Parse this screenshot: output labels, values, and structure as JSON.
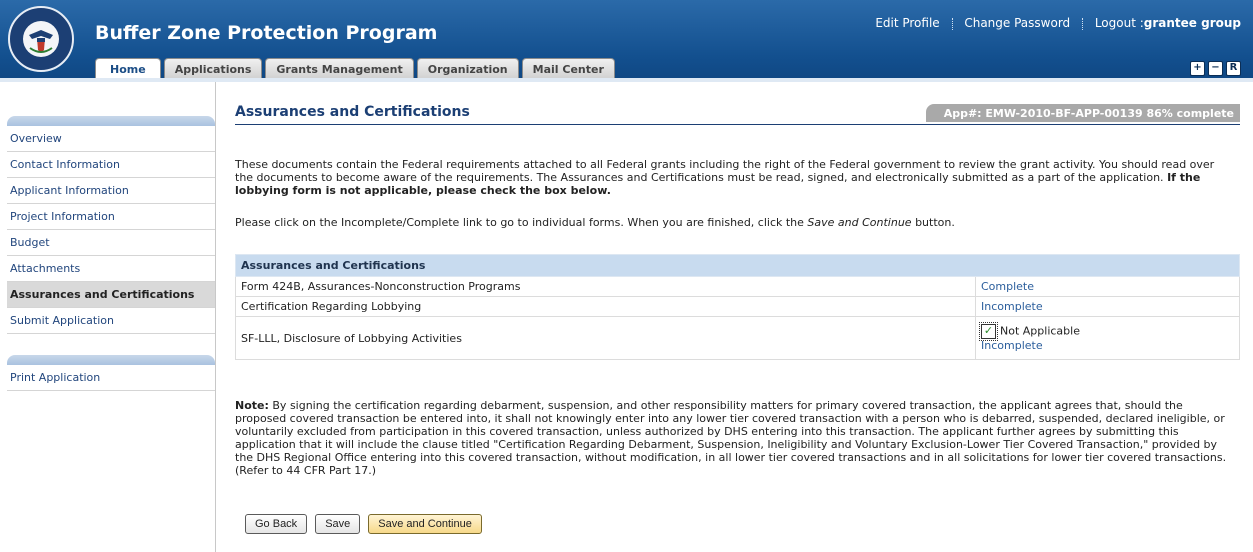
{
  "header": {
    "app_title": "Buffer Zone Protection Program",
    "links": {
      "edit_profile": "Edit Profile",
      "change_password": "Change Password",
      "logout": "Logout :",
      "user": "grantee group"
    },
    "tabs": [
      "Home",
      "Applications",
      "Grants Management",
      "Organization",
      "Mail Center"
    ],
    "window_buttons": [
      "+",
      "−",
      "R"
    ]
  },
  "sidebar": {
    "items": [
      "Overview",
      "Contact Information",
      "Applicant Information",
      "Project Information",
      "Budget",
      "Attachments",
      "Assurances and Certifications",
      "Submit Application"
    ],
    "active": "Assurances and Certifications",
    "print": "Print Application"
  },
  "main": {
    "title": "Assurances and Certifications",
    "app_number": "App#: EMW-2010-BF-APP-00139 86% complete",
    "intro_text": "These documents contain the Federal requirements attached to all Federal grants including the right of the Federal government to review the grant activity. You should read over the documents to become aware of the requirements. The Assurances and Certifications must be read, signed, and electronically submitted as a part of the application.",
    "intro_bold": "If the lobbying form is not applicable, please check the box below.",
    "instruction_pre": "Please click on the Incomplete/Complete link to go to individual forms. When you are finished, click the ",
    "instruction_em": "Save and Continue",
    "instruction_post": " button.",
    "table": {
      "header": "Assurances and Certifications",
      "rows": [
        {
          "form": "Form 424B, Assurances-Nonconstruction Programs",
          "status": "Complete"
        },
        {
          "form": "Certification Regarding Lobbying",
          "status": "Incomplete"
        },
        {
          "form": "SF-LLL, Disclosure of Lobbying Activities",
          "checkbox_label": "Not Applicable",
          "status": "Incomplete"
        }
      ]
    },
    "note_label": "Note:",
    "note_text": "By signing the certification regarding debarment, suspension, and other responsibility matters for primary covered transaction, the applicant agrees that, should the proposed covered transaction be entered into, it shall not knowingly enter into any lower tier covered transaction with a person who is debarred, suspended, declared ineligible, or voluntarily excluded from participation in this covered transaction, unless authorized by DHS entering into this transaction. The applicant further agrees by submitting this application that it will include the clause titled \"Certification Regarding Debarment, Suspension, Ineligibility and Voluntary Exclusion-Lower Tier Covered Transaction,\" provided by the DHS Regional Office entering into this covered transaction, without modification, in all lower tier covered transactions and in all solicitations for lower tier covered transactions. (Refer to 44 CFR Part 17.)",
    "buttons": {
      "go_back": "Go Back",
      "save": "Save",
      "save_continue": "Save and Continue"
    }
  }
}
